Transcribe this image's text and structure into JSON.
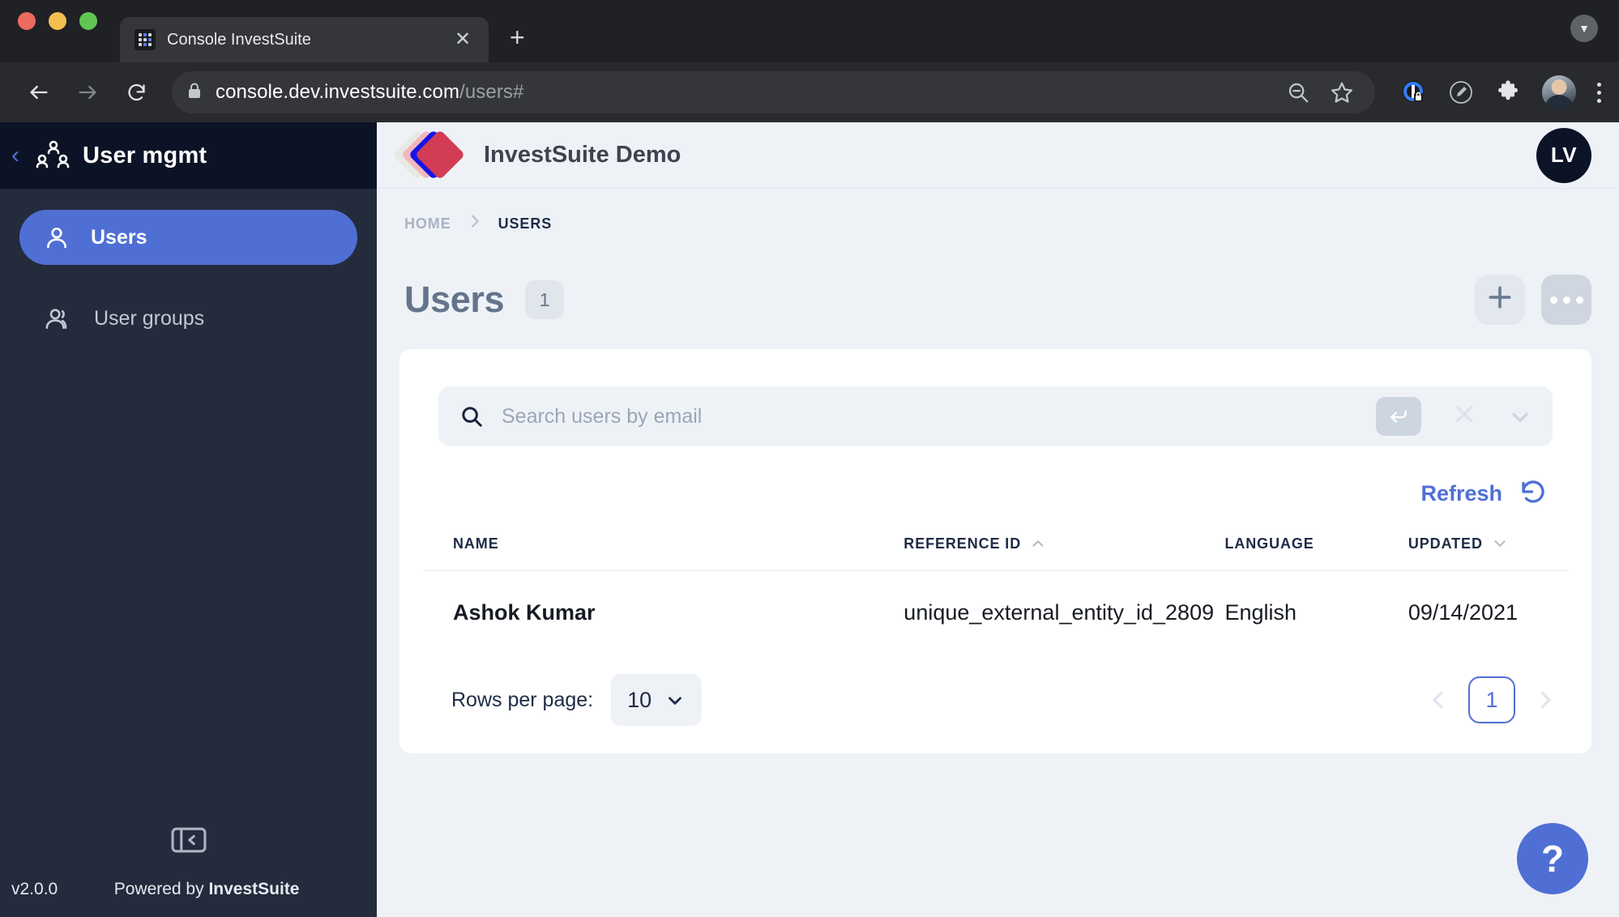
{
  "browser": {
    "tab": {
      "title": "Console InvestSuite",
      "favicon": "grid-icon",
      "close": "✕"
    },
    "new_tab": "+",
    "window_menu": "▼",
    "nav": {
      "back": "back-arrow-icon",
      "forward": "forward-arrow-icon",
      "reload": "reload-icon"
    },
    "omnibox": {
      "lock": "lock-icon",
      "url_main": "console.dev.investsuite.com",
      "url_dim": "/users#",
      "zoom_out": "zoom-out-icon",
      "bookmark": "star-icon"
    },
    "toolbar_icons": [
      "extension-shield-icon",
      "pencil-circle-icon",
      "puzzle-piece-icon",
      "profile-avatar",
      "kebab-menu-icon"
    ]
  },
  "sidebar": {
    "back": "‹",
    "title": "User mgmt",
    "items": [
      {
        "label": "Users",
        "icon": "person-icon",
        "active": true
      },
      {
        "label": "User groups",
        "icon": "people-icon",
        "active": false
      }
    ],
    "collapse": "collapse-panel-icon",
    "version": "v2.0.0",
    "powered_prefix": "Powered by ",
    "powered_brand": "InvestSuite"
  },
  "header": {
    "logo": "investsuite-diamond-logo",
    "title": "InvestSuite Demo",
    "avatar_initials": "LV"
  },
  "breadcrumb": {
    "home": "HOME",
    "separator": "›",
    "current": "USERS"
  },
  "page": {
    "title": "Users",
    "count": "1",
    "add_label": "+",
    "more_label": "…"
  },
  "search": {
    "placeholder": "Search users by email",
    "value": "",
    "enter_key": "↵",
    "clear": "✕",
    "expand": "chevron-down-icon"
  },
  "refresh": {
    "label": "Refresh",
    "icon": "rotate-ccw-icon"
  },
  "table": {
    "columns": [
      {
        "label": "NAME",
        "sort": ""
      },
      {
        "label": "REFERENCE ID",
        "sort": "asc"
      },
      {
        "label": "LANGUAGE",
        "sort": ""
      },
      {
        "label": "UPDATED",
        "sort": "desc"
      }
    ],
    "rows": [
      {
        "name": "Ashok Kumar",
        "reference_id": "unique_external_entity_id_2809",
        "language": "English",
        "updated": "09/14/2021"
      }
    ]
  },
  "pagination": {
    "rows_per_page_label": "Rows per page:",
    "rows_per_page_value": "10",
    "prev": "‹",
    "current_page": "1",
    "next": "›"
  },
  "help_fab": "?",
  "colors": {
    "accent_blue": "#4f6fd4",
    "sidebar_bg": "#242b3d",
    "sidebar_head_bg": "#0d1326",
    "page_bg": "#eef2f7",
    "logo_red": "#d23c55",
    "logo_blue": "#1415e8"
  }
}
